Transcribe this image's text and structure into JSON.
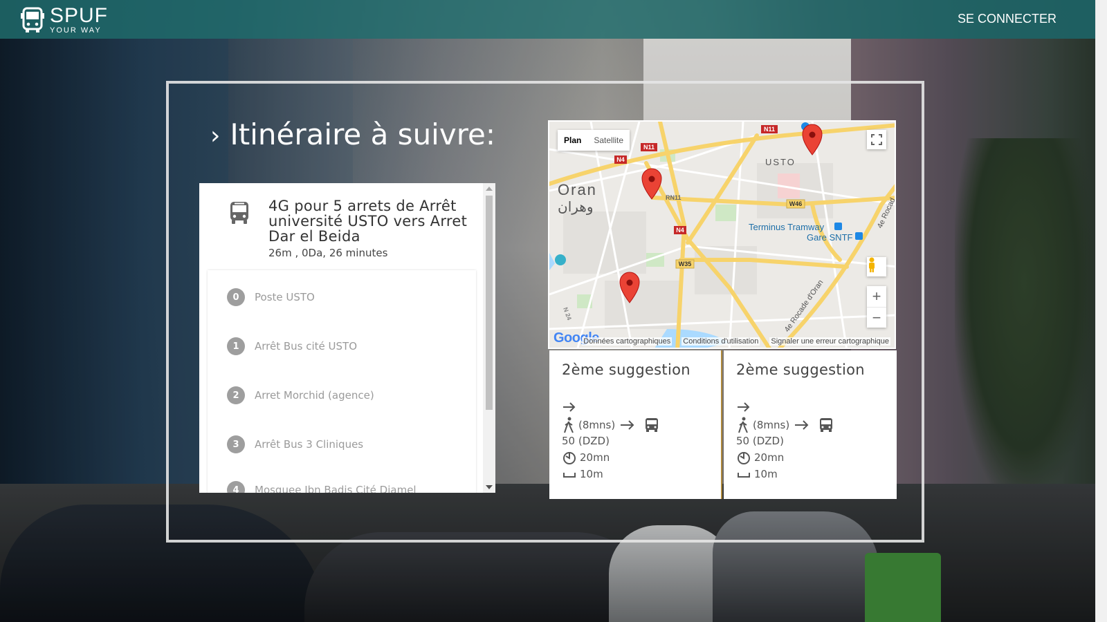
{
  "header": {
    "logo_name": "SPUF",
    "logo_tagline": "YOUR WAY",
    "login_label": "SE CONNECTER"
  },
  "page_title": "Itinéraire à suivre:",
  "itinerary": {
    "title": "4G pour 5 arrets de Arrêt université USTO vers Arret Dar el Beida",
    "subtitle": "26m , 0Da, 26 minutes",
    "stops": [
      {
        "num": "0",
        "name": "Poste USTO"
      },
      {
        "num": "1",
        "name": "Arrêt Bus cité USTO"
      },
      {
        "num": "2",
        "name": "Arret Morchid (agence)"
      },
      {
        "num": "3",
        "name": "Arrêt Bus 3 Cliniques"
      },
      {
        "num": "4",
        "name": "Mosquee Ibn Badis Cité Djamel"
      }
    ]
  },
  "map": {
    "type_plan": "Plan",
    "type_satellite": "Satellite",
    "label_oran": "Oran",
    "label_oran_ar": "وهران",
    "label_usto": "USTO",
    "label_terminus": "Terminus Tramway",
    "label_gare": "Gare SNTF",
    "label_rocade": "4e Rocade d'Oran",
    "label_rocade2": "4e Rocad",
    "roads": [
      "N11",
      "N11",
      "N4",
      "N4",
      "RN11",
      "W46",
      "W35",
      "N 24",
      "W35"
    ],
    "footer_data": "Données cartographiques",
    "footer_terms": "Conditions d'utilisation",
    "footer_report": "Signaler une erreur cartographique",
    "google": "Google"
  },
  "suggestions": [
    {
      "title": "2ème suggestion",
      "walk": "(8mns)",
      "price": "50 (DZD)",
      "time": "20mn",
      "distance": "10m"
    },
    {
      "title": "2ème suggestion",
      "walk": "(8mns)",
      "price": "50 (DZD)",
      "time": "20mn",
      "distance": "10m"
    }
  ],
  "colors": {
    "navbar": "#1e6e6e",
    "stop_badge": "#9e9e9e",
    "marker": "#ea4335",
    "road_yellow": "#f7d36b"
  },
  "icons": {
    "logo": "bus-icon",
    "itinerary": "bus-icon",
    "walk": "walk-icon",
    "arrow": "arrow-right-icon",
    "timer": "timer-icon",
    "distance": "ruler-icon"
  }
}
